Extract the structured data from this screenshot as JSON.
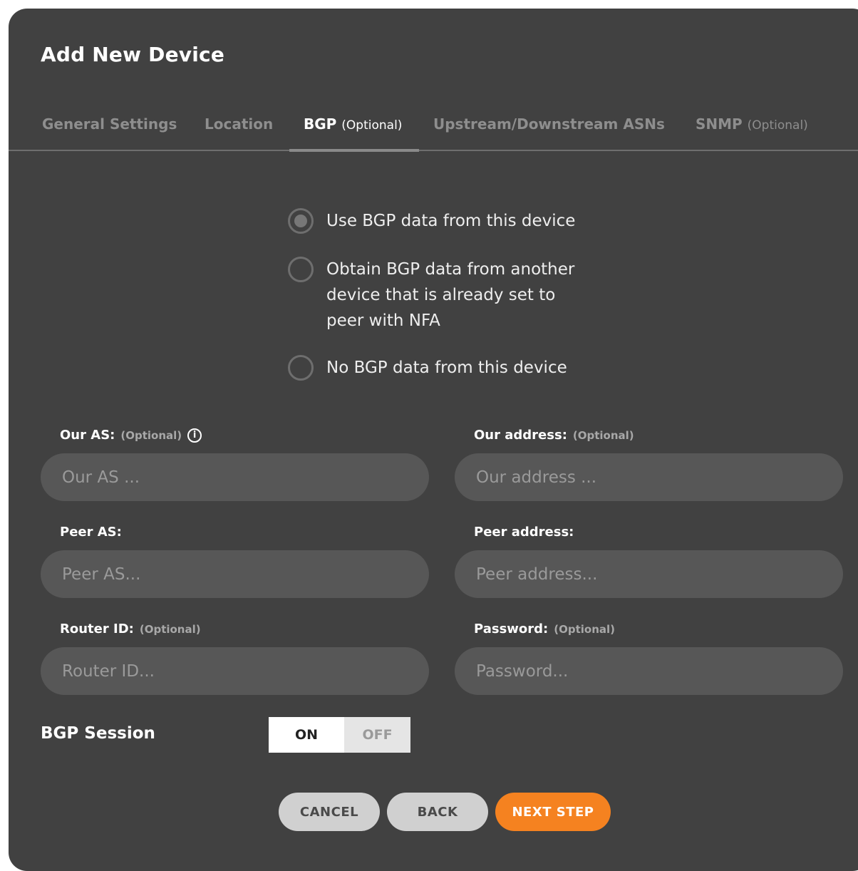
{
  "dialog": {
    "title": "Add New Device"
  },
  "tabs": [
    {
      "label": "General Settings",
      "optional": ""
    },
    {
      "label": "Location",
      "optional": ""
    },
    {
      "label": "BGP",
      "optional": "(Optional)"
    },
    {
      "label": "Upstream/Downstream ASNs",
      "optional": ""
    },
    {
      "label": "SNMP",
      "optional": "(Optional)"
    }
  ],
  "active_tab": "BGP",
  "bgp_source": {
    "options": [
      {
        "label": "Use BGP data from this device",
        "selected": true
      },
      {
        "label": "Obtain BGP data from another device that is already set to peer with NFA",
        "selected": false
      },
      {
        "label": "No BGP data from this device",
        "selected": false
      }
    ]
  },
  "fields": {
    "our_as": {
      "label": "Our AS:",
      "optional": "(Optional)",
      "placeholder": "Our AS ...",
      "value": ""
    },
    "our_address": {
      "label": "Our address:",
      "optional": "(Optional)",
      "placeholder": "Our address ...",
      "value": ""
    },
    "peer_as": {
      "label": "Peer AS:",
      "optional": "",
      "placeholder": "Peer AS...",
      "value": ""
    },
    "peer_address": {
      "label": "Peer address:",
      "optional": "",
      "placeholder": "Peer address...",
      "value": ""
    },
    "router_id": {
      "label": "Router ID:",
      "optional": "(Optional)",
      "placeholder": "Router ID...",
      "value": ""
    },
    "password": {
      "label": "Password:",
      "optional": "(Optional)",
      "placeholder": "Password...",
      "value": ""
    }
  },
  "bgp_session": {
    "label": "BGP Session",
    "on_label": "ON",
    "off_label": "OFF",
    "state": "ON"
  },
  "actions": {
    "cancel": "CANCEL",
    "back": "BACK",
    "next": "NEXT STEP"
  },
  "colors": {
    "background": "#414141",
    "input_bg": "#575757",
    "accent": "#f58220"
  }
}
